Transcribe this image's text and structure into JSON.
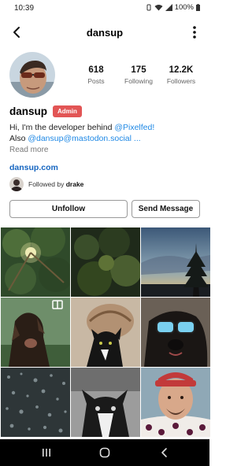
{
  "status_bar": {
    "time": "10:39",
    "battery": "100%"
  },
  "header": {
    "title": "dansup",
    "back_icon": "arrow-left-icon",
    "menu_icon": "more-vertical-icon"
  },
  "stats": [
    {
      "value": "618",
      "label": "Posts"
    },
    {
      "value": "175",
      "label": "Following"
    },
    {
      "value": "12.2K",
      "label": "Followers"
    }
  ],
  "profile": {
    "name": "dansup",
    "badge": "Admin",
    "bio_line1_prefix": "Hi, I'm the developer behind ",
    "bio_line1_link": "@Pixelfed!",
    "bio_line2_prefix": "Also ",
    "bio_line2_link": "@dansup@mastodon.social ...",
    "read_more": "Read more",
    "website": "dansup.com",
    "followed_by_prefix": "Followed by ",
    "followed_by_user": "drake"
  },
  "actions": {
    "unfollow": "Unfollow",
    "send_message": "Send Message"
  },
  "colors": {
    "accent_link": "#1e88e5",
    "badge_red": "#e25555",
    "website": "#1565c0"
  }
}
